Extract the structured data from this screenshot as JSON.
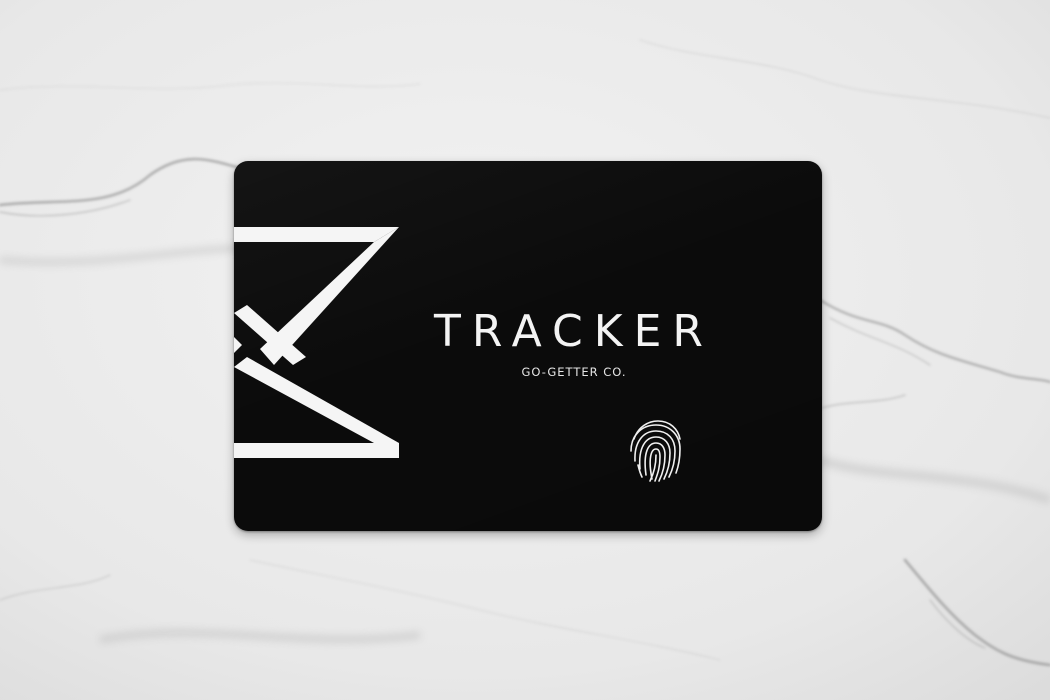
{
  "scene": {
    "background": "white-marble-surface",
    "background_color": "#ebebeb",
    "vein_color": "#9a9a9a"
  },
  "card": {
    "color": "#0b0b0b",
    "brand_name": "TRACKER",
    "tagline": "GO-GETTER CO.",
    "text_color": "#f4f4f4",
    "logo_icon": "hourglass-x-logo",
    "fingerprint_icon": "fingerprint-icon"
  }
}
